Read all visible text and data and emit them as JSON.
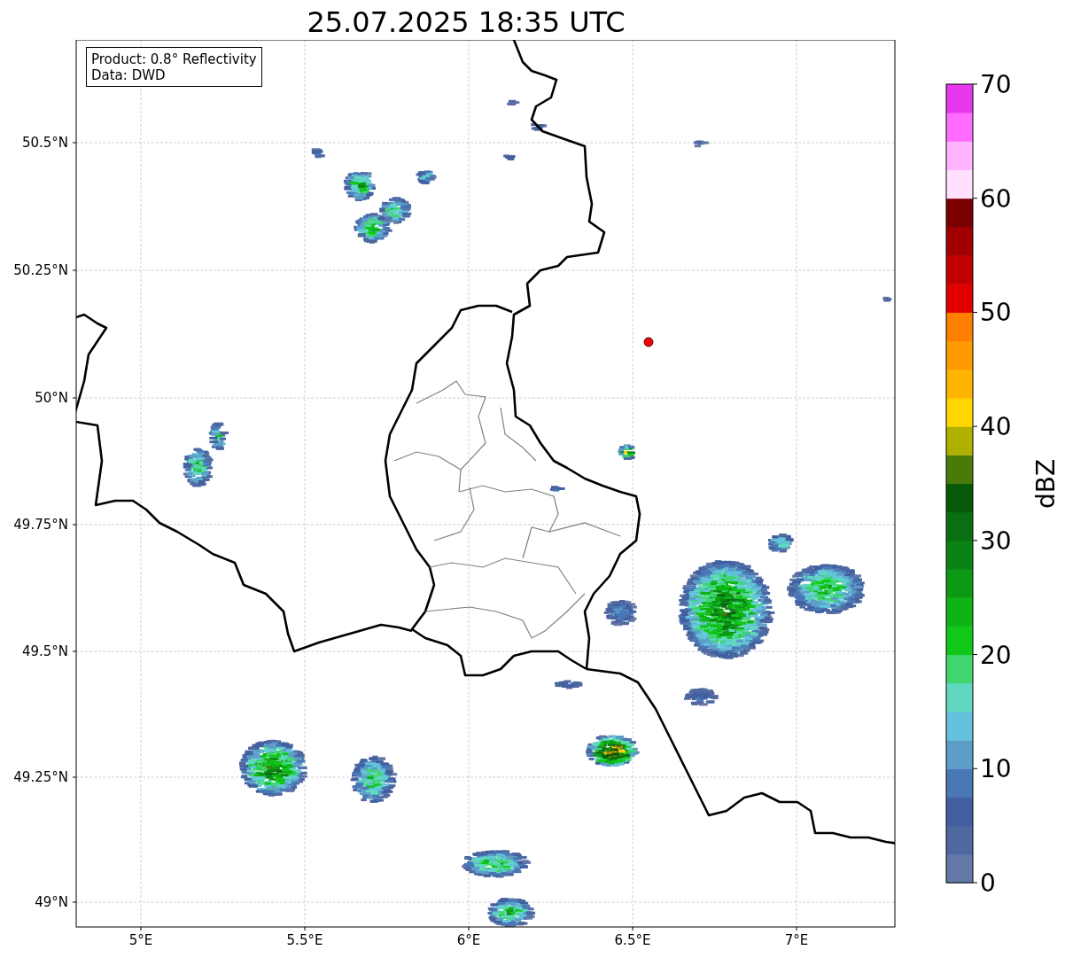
{
  "title": "25.07.2025 18:35 UTC",
  "info_box": {
    "product": "Product: 0.8° Reflectivity",
    "source": "Data: DWD"
  },
  "x_ticks": [
    "5°E",
    "5.5°E",
    "6°E",
    "6.5°E",
    "7°E"
  ],
  "y_ticks": [
    "50.5°N",
    "50.25°N",
    "50°N",
    "49.75°N",
    "49.5°N",
    "49.25°N",
    "49°N"
  ],
  "colorbar": {
    "label": "dBZ",
    "ticks": [
      "70",
      "60",
      "50",
      "40",
      "30",
      "20",
      "10",
      "0"
    ],
    "bins": [
      {
        "color": "#6478a8"
      },
      {
        "color": "#5068a0"
      },
      {
        "color": "#4260a0"
      },
      {
        "color": "#4a78b4"
      },
      {
        "color": "#5c9ec8"
      },
      {
        "color": "#64c2dc"
      },
      {
        "color": "#60d8c0"
      },
      {
        "color": "#3fd670"
      },
      {
        "color": "#10c818"
      },
      {
        "color": "#0eb416"
      },
      {
        "color": "#0c9a14"
      },
      {
        "color": "#0a8214"
      },
      {
        "color": "#0a6e12"
      },
      {
        "color": "#065a0a"
      },
      {
        "color": "#4a7a0a"
      },
      {
        "color": "#b0b000"
      },
      {
        "color": "#ffd700"
      },
      {
        "color": "#ffb400"
      },
      {
        "color": "#ff9a00"
      },
      {
        "color": "#ff7f00"
      },
      {
        "color": "#e00000"
      },
      {
        "color": "#c00000"
      },
      {
        "color": "#a00000"
      },
      {
        "color": "#7a0000"
      },
      {
        "color": "#ffe0ff"
      },
      {
        "color": "#ffb4ff"
      },
      {
        "color": "#ff6cff"
      },
      {
        "color": "#e838ee"
      }
    ]
  }
}
